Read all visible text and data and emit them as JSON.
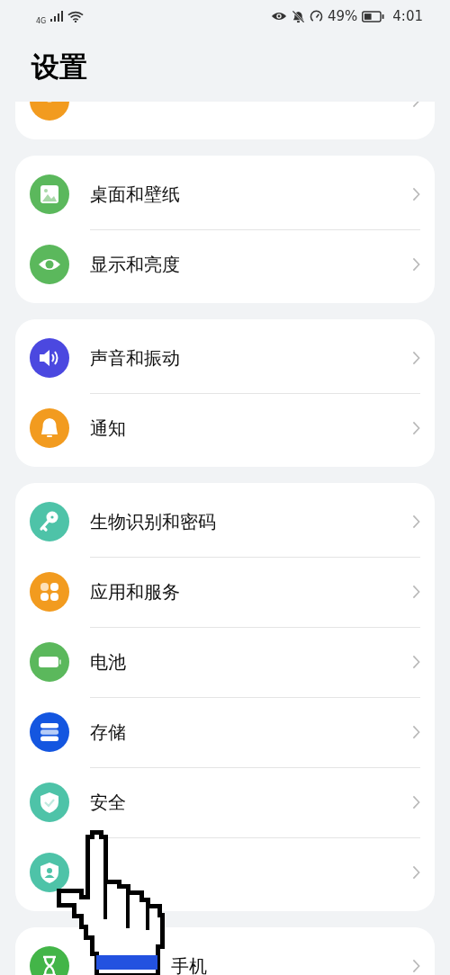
{
  "status_bar": {
    "network": "4G",
    "battery": "49%",
    "time": "4:01"
  },
  "title": "设置",
  "cards": [
    {
      "items": [
        {
          "kind": "link",
          "color": "#f29b1f"
        }
      ]
    },
    {
      "items": [
        {
          "kind": "image",
          "label": "桌面和壁纸",
          "color": "#5bb85c"
        },
        {
          "kind": "eye",
          "label": "显示和亮度",
          "color": "#5bb85c"
        }
      ]
    },
    {
      "items": [
        {
          "kind": "sound",
          "label": "声音和振动",
          "color": "#4b48e0"
        },
        {
          "kind": "bell",
          "label": "通知",
          "color": "#f29b1f"
        }
      ]
    },
    {
      "items": [
        {
          "kind": "key",
          "label": "生物识别和密码",
          "color": "#4ec3a8"
        },
        {
          "kind": "apps",
          "label": "应用和服务",
          "color": "#f29b1f"
        },
        {
          "kind": "battery",
          "label": "电池",
          "color": "#5bb85c"
        },
        {
          "kind": "storage",
          "label": "存储",
          "color": "#1456e0"
        },
        {
          "kind": "shield",
          "label": "安全",
          "color": "#4ec3a8"
        },
        {
          "kind": "privacy",
          "color": "#4ec3a8"
        }
      ]
    },
    {
      "items": [
        {
          "kind": "hourglass",
          "label": "手机",
          "covered": true,
          "color": "#43b548"
        }
      ]
    }
  ]
}
